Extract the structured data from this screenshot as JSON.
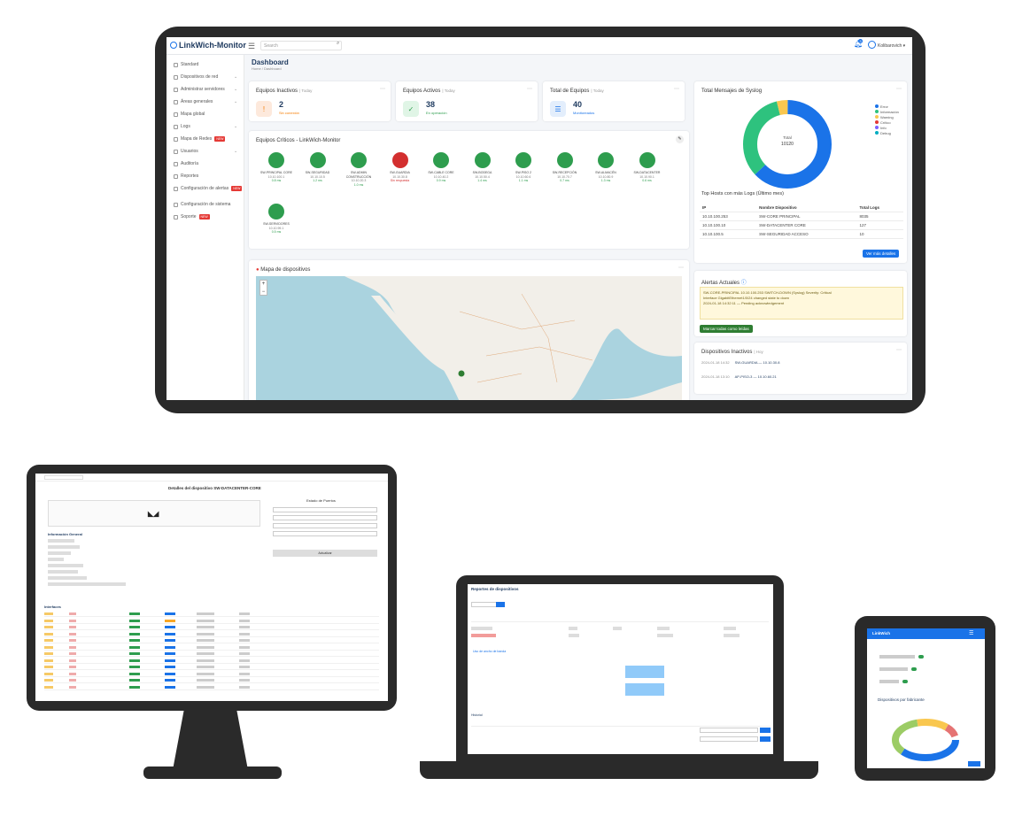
{
  "app": {
    "brand": "LinkWich-Monitor",
    "search_placeholder": "Search",
    "notif_count": "3",
    "user": "Kolibarovich"
  },
  "sidebar": {
    "items": [
      {
        "label": "Standard",
        "icon": "grid-icon"
      },
      {
        "label": "Dispositivos de red",
        "icon": "network-icon",
        "chev": true
      },
      {
        "label": "Administrar servidores",
        "icon": "server-icon",
        "chev": true
      },
      {
        "label": "Áreas generales",
        "icon": "area-icon",
        "chev": true
      },
      {
        "label": "Mapa global",
        "icon": "map-icon"
      },
      {
        "label": "Logs",
        "icon": "log-icon",
        "chev": true
      },
      {
        "label": "Mapa de Redes",
        "icon": "map-icon",
        "new": true
      },
      {
        "label": "Usuarios",
        "icon": "users-icon",
        "chev": true
      },
      {
        "label": "Auditoría",
        "icon": "audit-icon"
      },
      {
        "label": "Reportes",
        "icon": "report-icon"
      },
      {
        "label": "Configuración de alertas",
        "icon": "settings-icon",
        "new": true
      },
      {
        "label": "Configuración de sistema",
        "icon": "settings-icon"
      },
      {
        "label": "Soporte",
        "icon": "help-icon",
        "new": true
      }
    ],
    "new_label": "NEW"
  },
  "page": {
    "title": "Dashboard",
    "breadcrumb": "Home / Dashboard"
  },
  "stats": [
    {
      "title": "Equipos Inactivos",
      "period": "| Today",
      "value": "2",
      "sub": "Sin conexión",
      "color": "#f57c00",
      "bg": "#fde9dc",
      "icon": "alert-icon"
    },
    {
      "title": "Equipos Activos",
      "period": "| Today",
      "value": "38",
      "sub": "En operación",
      "color": "#2e9d4e",
      "bg": "#e0f5e6",
      "icon": "check-icon"
    },
    {
      "title": "Total de Equipos",
      "period": "| Today",
      "value": "40",
      "sub": "Monitoreados",
      "color": "#1a73e8",
      "bg": "#e3eefc",
      "icon": "list-icon"
    }
  ],
  "critical": {
    "title": "Equipos Críticos - LinkWich-Monitor",
    "devices": [
      {
        "name": "SW-PRINCIPAL CORE",
        "ip": "10.10.100.1",
        "lat": "0.8 ms",
        "color": "#2e9d4e"
      },
      {
        "name": "SW-SEGURIDAD",
        "ip": "10.10.10.5",
        "lat": "1.2 ms",
        "color": "#2e9d4e"
      },
      {
        "name": "SW-ADMIN CONSTRUCCIÓN",
        "ip": "10.10.20.3",
        "lat": "1.0 ms",
        "color": "#2e9d4e"
      },
      {
        "name": "SW-GUARDIA",
        "ip": "10.10.30.8",
        "lat": "Sin respuesta",
        "color": "#d32f2f"
      },
      {
        "name": "SW-CABLE CORE",
        "ip": "10.10.40.2",
        "lat": "0.9 ms",
        "color": "#2e9d4e"
      },
      {
        "name": "SW-BODEGA",
        "ip": "10.10.50.4",
        "lat": "1.4 ms",
        "color": "#2e9d4e"
      },
      {
        "name": "SW-PISO 2",
        "ip": "10.10.60.6",
        "lat": "1.1 ms",
        "color": "#2e9d4e"
      },
      {
        "name": "SW-RECEPCIÓN",
        "ip": "10.10.70.7",
        "lat": "0.7 ms",
        "color": "#2e9d4e"
      },
      {
        "name": "SW-ALMACÉN",
        "ip": "10.10.80.9",
        "lat": "1.3 ms",
        "color": "#2e9d4e"
      },
      {
        "name": "SW-DATACENTER",
        "ip": "10.10.90.1",
        "lat": "0.6 ms",
        "color": "#2e9d4e"
      },
      {
        "name": "SW-SERVIDORES",
        "ip": "10.10.99.1",
        "lat": "0.5 ms",
        "color": "#2e9d4e"
      }
    ]
  },
  "map_card": {
    "title": "Mapa de dispositivos",
    "zoom_in": "+",
    "zoom_out": "−"
  },
  "syslog": {
    "title": "Total Mensajes de Syslog",
    "center_label": "Total",
    "center_value": "10120",
    "legend": [
      {
        "label": "Error",
        "color": "#1a73e8"
      },
      {
        "label": "Información",
        "color": "#2ec27e"
      },
      {
        "label": "Warning",
        "color": "#f9c74f"
      },
      {
        "label": "Crítico",
        "color": "#e53935"
      },
      {
        "label": "Info",
        "color": "#7b61ff"
      },
      {
        "label": "Debug",
        "color": "#00acc1"
      }
    ],
    "slices": [
      {
        "value": 63,
        "color": "#1a73e8"
      },
      {
        "value": 33,
        "color": "#2ec27e"
      },
      {
        "value": 4,
        "color": "#f9c74f"
      }
    ]
  },
  "top_logs": {
    "title": "Top Hosts con más Logs (Último mes)",
    "headers": [
      "IP",
      "Nombre Dispositivo",
      "Total Logs"
    ],
    "rows": [
      [
        "10.10.100.253",
        "SW-CORE PRINCIPAL",
        "8035"
      ],
      [
        "10.10.100.10",
        "SW-DATACENTER CORE",
        "127"
      ],
      [
        "10.10.100.5",
        "SW-SEGURIDAD ACCESO",
        "10"
      ]
    ],
    "button": "Ver más detalles"
  },
  "alerts": {
    "title": "Alertas Actuales",
    "lines": [
      "SW-CORE-PRINCIPAL 10.10.100.253 SWITCH-DOWN (Syslog) Severity: Critical",
      "Interface GigabitEthernet1/0/24 changed state to down",
      "2024-01-18 14:32:11 — Pending acknowledgement"
    ],
    "button": "Marcar todas como leídas"
  },
  "recent": {
    "title": "Dispositivos Inactivos",
    "period": "| Hoy",
    "items": [
      {
        "time": "2024-01-18 14:32",
        "text": "SW-GUARDIA — 10.10.30.8"
      },
      {
        "time": "2024-01-18 13:10",
        "text": "AP-PISO-3 — 10.10.60.21"
      }
    ]
  },
  "secondary": {
    "title": "Detalles del dispositivo SW-DATACENTER-CORE",
    "info_title": "Información General",
    "ports_title": "Estado de Puertos",
    "ports_button": "Actualizar",
    "table_title": "Interfaces"
  },
  "laptop": {
    "title": "Reportes de dispositivos",
    "chart_title": "Uso de ancho de banda",
    "table_title": "Historial"
  },
  "tablet": {
    "brand": "LinkWich",
    "chart_title": "Dispositivos por fabricante"
  }
}
